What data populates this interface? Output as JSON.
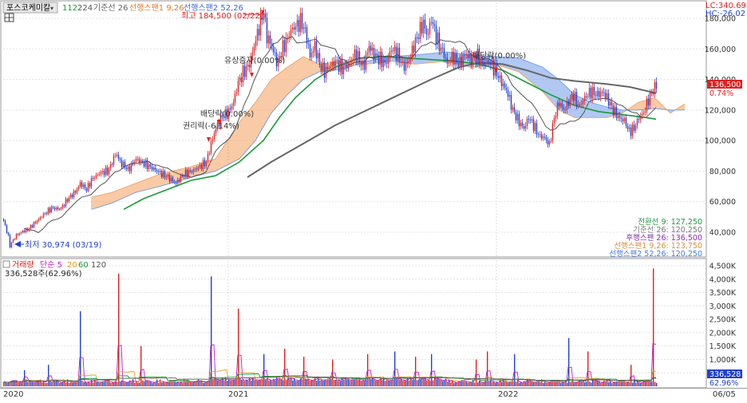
{
  "header": {
    "stock_name": "포스코케미칼",
    "ma_a": "112",
    "ma_b": "224",
    "base_label": "기준선 26",
    "span1_label": "선행스팬1 9,26",
    "span2_label": "선행스팬2 52,26",
    "high_note": "최고 184,500 (02/22)",
    "low_note": "최저 30,974 (03/19)",
    "lc": "LC:340.69",
    "hc": "HC:-26.02"
  },
  "events": {
    "rights_issue": "유상증자(0.00%)",
    "dividend_1": "배당락(0.00%)",
    "ex_rights": "권리락(-6.14%)",
    "dividend_2": "배당락(0.00%)"
  },
  "price_tag": {
    "value": "136,500",
    "change": "0.74%"
  },
  "legend": [
    {
      "text": "전환선 9: 127,250",
      "color": "#1a9a3a"
    },
    {
      "text": "기준선 26: 120,250",
      "color": "#777777"
    },
    {
      "text": "후행스팬 26: 136,500",
      "color": "#8a2bb8"
    },
    {
      "text": "선행스팬1 9,26: 123,750",
      "color": "#d98f3a"
    },
    {
      "text": "선행스팬2 52,26: 120,250",
      "color": "#4a7bd8"
    }
  ],
  "volume_header": {
    "title": "거래량",
    "ma_label": "단순 5",
    "m20": "20",
    "m60": "60",
    "m120": "120",
    "current": "336,528주(62.96%)"
  },
  "volume_tag": {
    "value": "336,528",
    "pct": "62.96%"
  },
  "colors": {
    "up": "#e02020",
    "down": "#2040d0",
    "cloud_up": "#f2a66a",
    "cloud_down": "#7aa2e8",
    "ma_green": "#1a9a3a",
    "ma_gray": "#666666"
  },
  "chart_data": {
    "type": "line",
    "price_axis": {
      "ylim": [
        30000,
        190000
      ],
      "ticks": [
        "40,000",
        "60,000",
        "80,000",
        "100,000",
        "120,000",
        "140,000",
        "160,000",
        "180,000"
      ]
    },
    "volume_axis": {
      "ylim": [
        0,
        4600
      ],
      "ticks": [
        "500K",
        "1,000K",
        "1,500K",
        "2,000K",
        "2,500K",
        "3,000K",
        "3,500K",
        "4,000K",
        "4,500K"
      ]
    },
    "x_labels": [
      "2020",
      "2021",
      "2022",
      "06/05"
    ],
    "close_series": [
      [
        0,
        52000
      ],
      [
        5,
        46000
      ],
      [
        10,
        37000
      ],
      [
        12,
        31000
      ],
      [
        15,
        34000
      ],
      [
        20,
        38000
      ],
      [
        28,
        40500
      ],
      [
        35,
        42000
      ],
      [
        45,
        47000
      ],
      [
        55,
        52000
      ],
      [
        65,
        56000
      ],
      [
        75,
        55000
      ],
      [
        85,
        62000
      ],
      [
        95,
        67000
      ],
      [
        100,
        72000
      ],
      [
        108,
        68000
      ],
      [
        115,
        75000
      ],
      [
        125,
        79000
      ],
      [
        135,
        80000
      ],
      [
        145,
        92000
      ],
      [
        150,
        86000
      ],
      [
        160,
        81000
      ],
      [
        170,
        88000
      ],
      [
        180,
        85000
      ],
      [
        190,
        82000
      ],
      [
        200,
        79000
      ],
      [
        210,
        76000
      ],
      [
        220,
        72000
      ],
      [
        230,
        78000
      ],
      [
        240,
        80000
      ],
      [
        250,
        83000
      ],
      [
        258,
        86000
      ],
      [
        265,
        100000
      ],
      [
        270,
        108000
      ],
      [
        278,
        116000
      ],
      [
        285,
        118000
      ],
      [
        292,
        125000
      ],
      [
        298,
        138000
      ],
      [
        305,
        145000
      ],
      [
        312,
        150000
      ],
      [
        318,
        162000
      ],
      [
        323,
        172000
      ],
      [
        327,
        180000
      ],
      [
        330,
        184500
      ],
      [
        334,
        168000
      ],
      [
        340,
        162000
      ],
      [
        347,
        150000
      ],
      [
        352,
        158000
      ],
      [
        358,
        165000
      ],
      [
        364,
        172000
      ],
      [
        370,
        175000
      ],
      [
        377,
        178000
      ],
      [
        383,
        170000
      ],
      [
        388,
        155000
      ],
      [
        394,
        162000
      ],
      [
        400,
        150000
      ],
      [
        406,
        145000
      ],
      [
        412,
        148000
      ],
      [
        420,
        152000
      ],
      [
        428,
        147000
      ],
      [
        436,
        150000
      ],
      [
        445,
        157000
      ],
      [
        455,
        148000
      ],
      [
        462,
        162000
      ],
      [
        468,
        156000
      ],
      [
        476,
        153000
      ],
      [
        483,
        150000
      ],
      [
        490,
        160000
      ],
      [
        497,
        157000
      ],
      [
        505,
        148000
      ],
      [
        512,
        152000
      ],
      [
        518,
        162000
      ],
      [
        524,
        170000
      ],
      [
        530,
        177000
      ],
      [
        535,
        168000
      ],
      [
        540,
        180000
      ],
      [
        545,
        170000
      ],
      [
        550,
        162000
      ],
      [
        555,
        158000
      ],
      [
        560,
        150000
      ],
      [
        567,
        155000
      ],
      [
        575,
        150000
      ],
      [
        583,
        157000
      ],
      [
        590,
        153000
      ],
      [
        598,
        155000
      ],
      [
        605,
        150000
      ],
      [
        612,
        152000
      ],
      [
        620,
        146000
      ],
      [
        628,
        138000
      ],
      [
        635,
        132000
      ],
      [
        642,
        120000
      ],
      [
        650,
        112000
      ],
      [
        656,
        108000
      ],
      [
        662,
        115000
      ],
      [
        668,
        110000
      ],
      [
        675,
        103000
      ],
      [
        682,
        102000
      ],
      [
        688,
        97000
      ],
      [
        694,
        115000
      ],
      [
        700,
        125000
      ],
      [
        706,
        120000
      ],
      [
        712,
        125000
      ],
      [
        718,
        130000
      ],
      [
        725,
        122000
      ],
      [
        732,
        128000
      ],
      [
        740,
        132000
      ],
      [
        748,
        130000
      ],
      [
        755,
        132000
      ],
      [
        762,
        126000
      ],
      [
        768,
        120000
      ],
      [
        775,
        115000
      ],
      [
        782,
        113000
      ],
      [
        788,
        106000
      ],
      [
        794,
        108000
      ],
      [
        800,
        115000
      ],
      [
        806,
        118000
      ],
      [
        812,
        127000
      ],
      [
        818,
        133000
      ],
      [
        822,
        136500
      ]
    ],
    "cloud": [
      [
        115,
        63000,
        55000
      ],
      [
        140,
        66000,
        59000
      ],
      [
        170,
        72000,
        66000
      ],
      [
        200,
        78000,
        70000
      ],
      [
        240,
        83000,
        76000
      ],
      [
        270,
        88000,
        80000
      ],
      [
        300,
        112000,
        88000
      ],
      [
        320,
        125000,
        100000
      ],
      [
        340,
        140000,
        118000
      ],
      [
        360,
        148000,
        130000
      ],
      [
        380,
        155000,
        140000
      ],
      [
        400,
        150000,
        145000
      ],
      [
        430,
        152000,
        147000
      ],
      [
        460,
        150000,
        152000
      ],
      [
        490,
        152000,
        155000
      ],
      [
        520,
        150000,
        156000
      ],
      [
        560,
        152000,
        158000
      ],
      [
        590,
        148000,
        156000
      ],
      [
        620,
        150000,
        155000
      ],
      [
        650,
        145000,
        154000
      ],
      [
        680,
        132000,
        148000
      ],
      [
        700,
        120000,
        140000
      ],
      [
        720,
        115000,
        130000
      ],
      [
        740,
        115000,
        125000
      ],
      [
        760,
        115000,
        122000
      ],
      [
        780,
        118000,
        120000
      ],
      [
        800,
        125000,
        120000
      ],
      [
        820,
        128000,
        121000
      ],
      [
        840,
        118000,
        120000
      ],
      [
        858,
        124000,
        120000
      ]
    ],
    "ma_green": [
      [
        155,
        55000
      ],
      [
        180,
        62000
      ],
      [
        210,
        68000
      ],
      [
        240,
        74000
      ],
      [
        270,
        77000
      ],
      [
        300,
        86000
      ],
      [
        330,
        100000
      ],
      [
        350,
        115000
      ],
      [
        370,
        128000
      ],
      [
        395,
        140000
      ],
      [
        420,
        148000
      ],
      [
        450,
        154000
      ],
      [
        480,
        155000
      ],
      [
        510,
        154000
      ],
      [
        540,
        153000
      ],
      [
        570,
        152000
      ],
      [
        600,
        150000
      ],
      [
        630,
        146000
      ],
      [
        660,
        138000
      ],
      [
        690,
        130000
      ],
      [
        720,
        123000
      ],
      [
        750,
        119000
      ],
      [
        780,
        117000
      ],
      [
        810,
        115000
      ],
      [
        822,
        114000
      ]
    ],
    "ma_gray": [
      [
        310,
        76000
      ],
      [
        340,
        86000
      ],
      [
        380,
        98000
      ],
      [
        420,
        110000
      ],
      [
        460,
        120000
      ],
      [
        500,
        130000
      ],
      [
        540,
        140000
      ],
      [
        575,
        148000
      ],
      [
        600,
        151000
      ],
      [
        630,
        150000
      ],
      [
        660,
        146000
      ],
      [
        690,
        141000
      ],
      [
        720,
        139000
      ],
      [
        760,
        137000
      ],
      [
        790,
        135000
      ],
      [
        822,
        131000
      ]
    ],
    "volume_spikes": [
      [
        30,
        600
      ],
      [
        60,
        800
      ],
      [
        100,
        2800
      ],
      [
        148,
        4200
      ],
      [
        176,
        1500
      ],
      [
        264,
        4100
      ],
      [
        297,
        2900
      ],
      [
        330,
        1200
      ],
      [
        356,
        1400
      ],
      [
        380,
        1100
      ],
      [
        416,
        1000
      ],
      [
        460,
        1200
      ],
      [
        494,
        1300
      ],
      [
        520,
        1100
      ],
      [
        540,
        1200
      ],
      [
        596,
        1000
      ],
      [
        610,
        1300
      ],
      [
        644,
        1200
      ],
      [
        712,
        1800
      ],
      [
        736,
        1300
      ],
      [
        790,
        800
      ],
      [
        818,
        4400
      ]
    ]
  }
}
